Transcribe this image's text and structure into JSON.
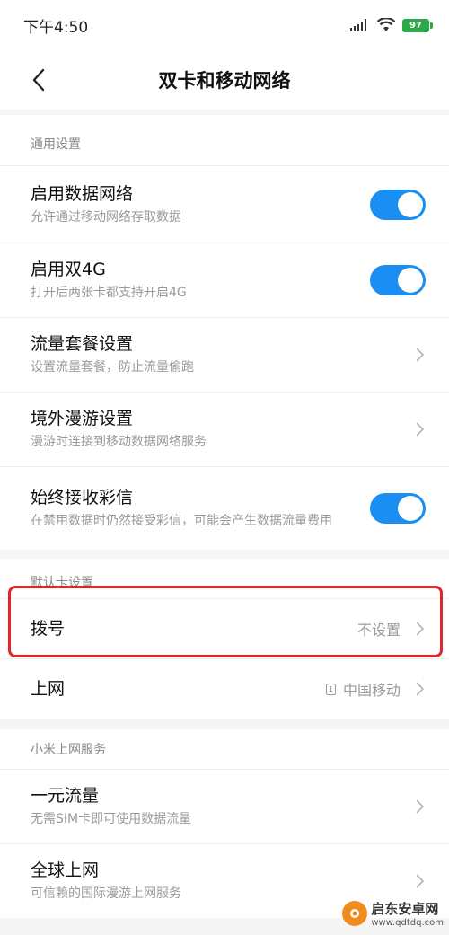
{
  "status_bar": {
    "time": "下午4:50",
    "battery": "97"
  },
  "header": {
    "title": "双卡和移动网络"
  },
  "sections": {
    "general": {
      "header": "通用设置",
      "items": [
        {
          "title": "启用数据网络",
          "subtitle": "允许通过移动网络存取数据",
          "toggle": true
        },
        {
          "title": "启用双4G",
          "subtitle": "打开后两张卡都支持开启4G",
          "toggle": true
        },
        {
          "title": "流量套餐设置",
          "subtitle": "设置流量套餐，防止流量偷跑"
        },
        {
          "title": "境外漫游设置",
          "subtitle": "漫游时连接到移动数据网络服务"
        },
        {
          "title": "始终接收彩信",
          "subtitle": "在禁用数据时仍然接受彩信，可能会产生数据流量费用",
          "toggle": true
        }
      ]
    },
    "default_card": {
      "header": "默认卡设置",
      "items": [
        {
          "title": "拨号",
          "value": "不设置"
        },
        {
          "title": "上网",
          "sim": "1",
          "value": "中国移动"
        }
      ]
    },
    "mi_service": {
      "header": "小米上网服务",
      "items": [
        {
          "title": "一元流量",
          "subtitle": "无需SIM卡即可使用数据流量"
        },
        {
          "title": "全球上网",
          "subtitle": "可信赖的国际漫游上网服务"
        }
      ]
    }
  },
  "watermark": {
    "name": "启东安卓网",
    "url": "www.qdtdq.com"
  },
  "colors": {
    "accent": "#1a8ef2",
    "highlight": "#e0262b"
  }
}
